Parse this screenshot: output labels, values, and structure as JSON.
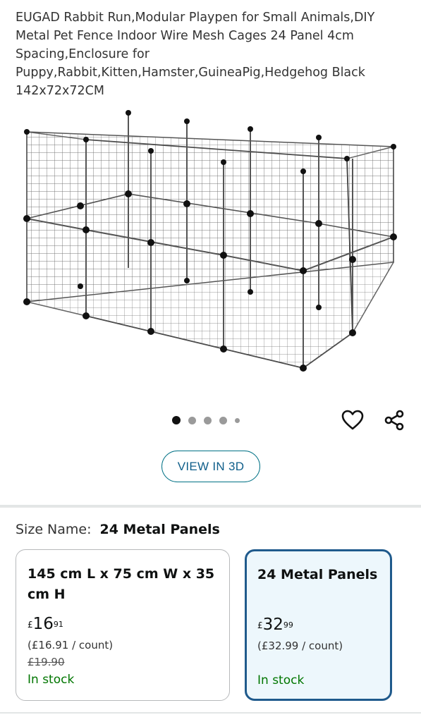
{
  "product": {
    "title": "EUGAD Rabbit Run,Modular Playpen for Small Animals,DIY Metal Pet Fence Indoor Wire Mesh Cages 24 Panel 4cm Spacing,Enclosure for Puppy,Rabbit,Kitten,Hamster,GuineaPig,Hedgehog Black 142x72x72CM"
  },
  "gallery": {
    "image_count": 5,
    "active_index": 0,
    "view_3d_label": "VIEW IN 3D"
  },
  "icons": {
    "wishlist": "heart-icon",
    "share": "share-icon"
  },
  "size": {
    "label": "Size Name:",
    "selected": "24 Metal Panels",
    "options": [
      {
        "name": "145 cm L x 75 cm W x 35 cm H",
        "currency": "£",
        "price_whole": "16",
        "price_fraction": "91",
        "per_count": "(£16.91 / count)",
        "was_price": "£19.90",
        "stock": "In stock"
      },
      {
        "name": "24 Metal Panels",
        "currency": "£",
        "price_whole": "32",
        "price_fraction": "99",
        "per_count": "(£32.99 / count)",
        "stock": "In stock"
      }
    ]
  },
  "colors": {
    "accent": "#007185",
    "selected_border": "#1f5a8c",
    "selected_bg": "#edf7fc",
    "in_stock": "#007600"
  }
}
